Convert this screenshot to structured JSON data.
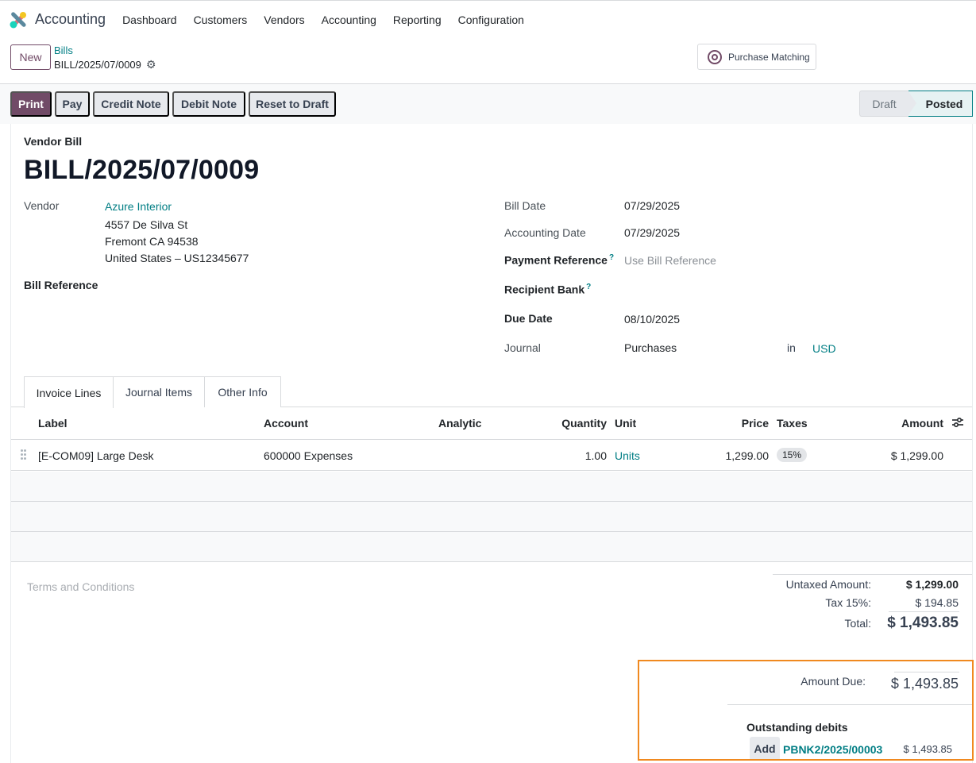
{
  "navbar": {
    "app_name": "Accounting",
    "menu": [
      "Dashboard",
      "Customers",
      "Vendors",
      "Accounting",
      "Reporting",
      "Configuration"
    ]
  },
  "control_panel": {
    "new_label": "New",
    "breadcrumb_parent": "Bills",
    "record_name": "BILL/2025/07/0009",
    "purchase_matching_label": "Purchase Matching"
  },
  "actions": {
    "print": "Print",
    "pay": "Pay",
    "credit_note": "Credit Note",
    "debit_note": "Debit Note",
    "reset_to_draft": "Reset to Draft"
  },
  "status": {
    "draft": "Draft",
    "posted": "Posted",
    "current": "Posted"
  },
  "form": {
    "doc_type": "Vendor Bill",
    "title": "BILL/2025/07/0009",
    "vendor_label": "Vendor",
    "vendor_name": "Azure Interior",
    "vendor_address_1": "4557 De Silva St",
    "vendor_address_2": "Fremont CA 94538",
    "vendor_address_3": "United States – US12345677",
    "bill_reference_label": "Bill Reference",
    "bill_date_label": "Bill Date",
    "bill_date": "07/29/2025",
    "accounting_date_label": "Accounting Date",
    "accounting_date": "07/29/2025",
    "payment_reference_label": "Payment Reference",
    "payment_reference_placeholder": "Use Bill Reference",
    "recipient_bank_label": "Recipient Bank",
    "due_date_label": "Due Date",
    "due_date": "08/10/2025",
    "journal_label": "Journal",
    "journal": "Purchases",
    "in_label": "in",
    "currency": "USD",
    "help_mark": "?"
  },
  "tabs": [
    "Invoice Lines",
    "Journal Items",
    "Other Info"
  ],
  "lines": {
    "headers": {
      "label": "Label",
      "account": "Account",
      "analytic": "Analytic",
      "quantity": "Quantity",
      "unit": "Unit",
      "price": "Price",
      "taxes": "Taxes",
      "amount": "Amount"
    },
    "rows": [
      {
        "label": "[E-COM09] Large Desk",
        "account": "600000 Expenses",
        "analytic": "",
        "quantity": "1.00",
        "unit": "Units",
        "price": "1,299.00",
        "taxes": "15%",
        "amount": "$ 1,299.00"
      }
    ]
  },
  "terms_placeholder": "Terms and Conditions",
  "totals": {
    "untaxed_label": "Untaxed Amount:",
    "untaxed": "$ 1,299.00",
    "tax_label": "Tax 15%:",
    "tax": "$ 194.85",
    "total_label": "Total:",
    "total": "$ 1,493.85",
    "amount_due_label": "Amount Due:",
    "amount_due": "$ 1,493.85"
  },
  "outstanding": {
    "title": "Outstanding debits",
    "add_label": "Add",
    "ref": "PBNK2/2025/00003",
    "amount": "$ 1,493.85"
  },
  "colors": {
    "primary": "#714b67",
    "link": "#017e84",
    "highlight": "#f0891f"
  }
}
